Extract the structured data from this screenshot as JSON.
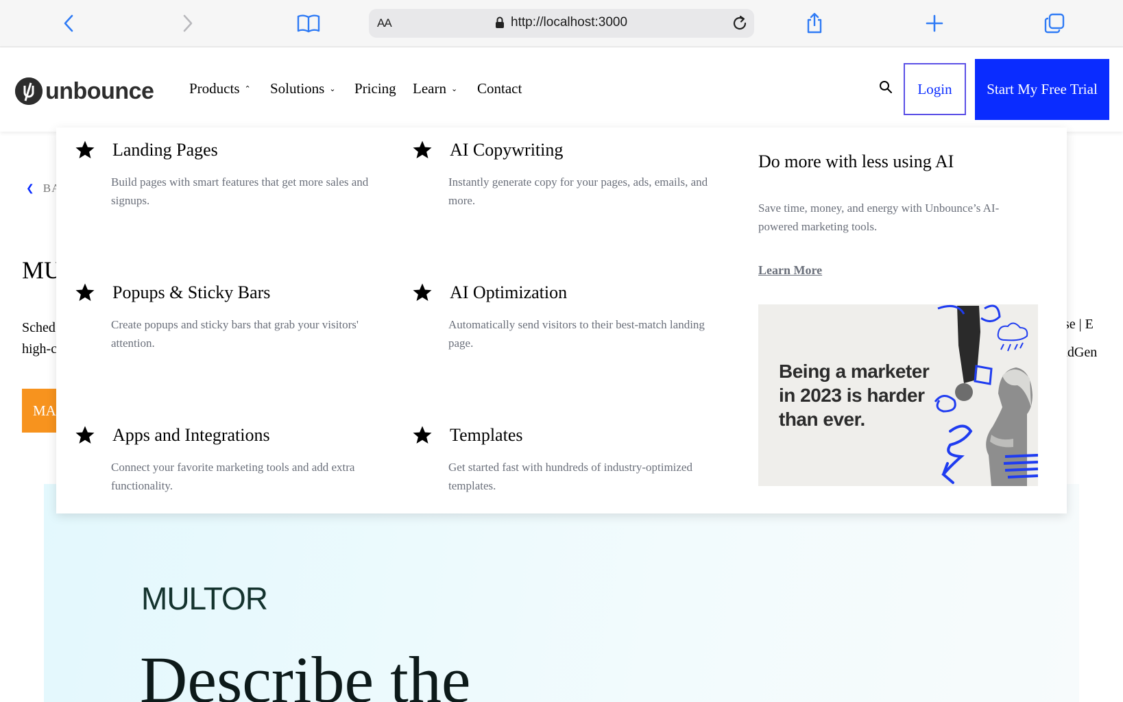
{
  "browser": {
    "url_aa": "AA",
    "url": "http://localhost:3000",
    "icons": [
      "back-icon",
      "forward-icon",
      "bookmarks-icon",
      "lock-icon",
      "reload-icon",
      "share-icon",
      "new-tab-icon",
      "tabs-icon"
    ]
  },
  "header": {
    "logo_text": "unbounce",
    "nav": [
      {
        "label": "Products",
        "has_caret": true,
        "caret": "up"
      },
      {
        "label": "Solutions",
        "has_caret": true,
        "caret": "down"
      },
      {
        "label": "Pricing",
        "has_caret": false
      },
      {
        "label": "Learn",
        "has_caret": true,
        "caret": "down"
      },
      {
        "label": "Contact",
        "has_caret": false
      }
    ],
    "login_label": "Login",
    "trial_label": "Start My Free Trial",
    "colors": {
      "brand_blue": "#0a2cff",
      "login_border": "#5a4fe6"
    }
  },
  "page": {
    "back_label": "BA",
    "title_partial": "MU",
    "desc_line1_partial": "Sched",
    "desc_line2_partial": "high-c",
    "desc_right1_partial": "se | E",
    "desc_right2_partial": "adGen",
    "cta_partial": "MA",
    "cta_color": "#f7931e",
    "hero_logo": "MULTOR",
    "hero_heading_partial": "Describe the"
  },
  "mega_menu": {
    "items": [
      {
        "title": "Landing Pages",
        "desc": "Build pages with smart features that get more sales and signups."
      },
      {
        "title": "AI Copywriting",
        "desc": "Instantly generate copy for your pages, ads, emails, and more."
      },
      {
        "title": "Popups & Sticky Bars",
        "desc": "Create popups and sticky bars that grab your visitors' attention."
      },
      {
        "title": "AI Optimization",
        "desc": "Automatically send visitors to their best-match landing page."
      },
      {
        "title": "Apps and Integrations",
        "desc": "Connect your favorite marketing tools and add extra functionality."
      },
      {
        "title": "Templates",
        "desc": "Get started fast with hundreds of industry-optimized templates."
      }
    ],
    "promo": {
      "title": "Do more with less using AI",
      "desc": "Save time, money, and energy with Unbounce’s AI-powered marketing tools.",
      "link": "Learn More",
      "image_caption": "Being a marketer in 2023 is harder than ever."
    }
  }
}
